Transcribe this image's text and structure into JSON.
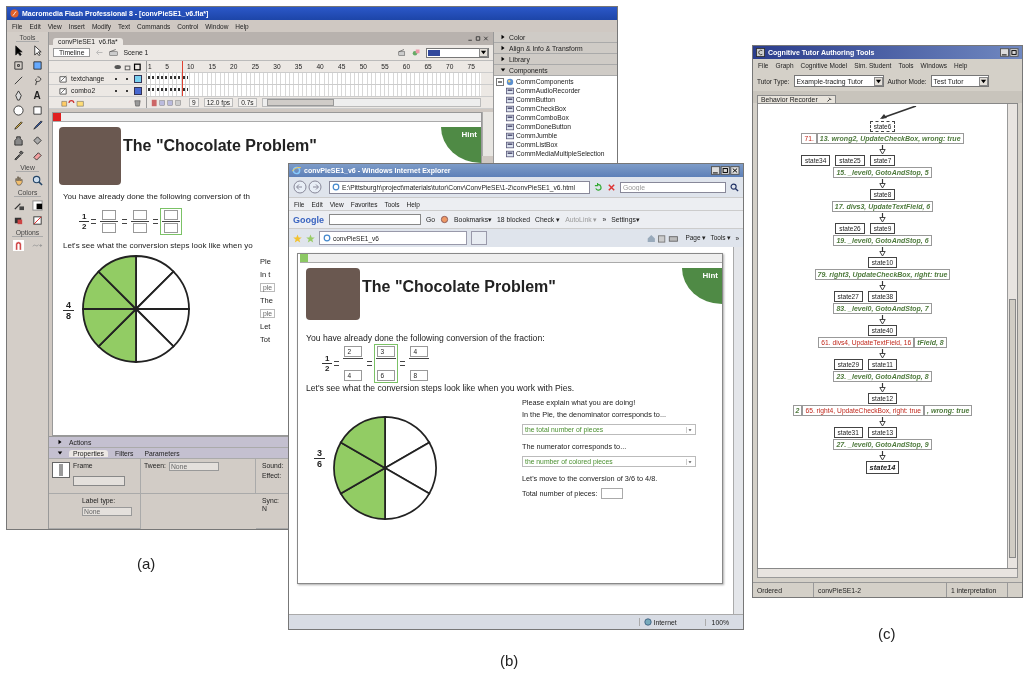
{
  "flash": {
    "title": "Macromedia Flash Professional 8 - [convPieSE1_v6.fla*]",
    "menu": [
      "File",
      "Edit",
      "View",
      "Insert",
      "Modify",
      "Text",
      "Commands",
      "Control",
      "Window",
      "Help"
    ],
    "tools": {
      "heading": "Tools",
      "text_tool": "A",
      "view": "View",
      "colors": "Colors",
      "options": "Options"
    },
    "doc_tab": "convPieSE1_v6.fla*",
    "timeline_button": "Timeline",
    "scene": "Scene 1",
    "frame_numbers": [
      "1",
      "5",
      "10",
      "15",
      "20",
      "25",
      "30",
      "35",
      "40",
      "45",
      "50",
      "55",
      "60",
      "65",
      "70",
      "75"
    ],
    "layers": [
      {
        "name": "textchange",
        "color": "#78d0f0"
      },
      {
        "name": "combo2",
        "color": "#4868d0"
      }
    ],
    "timeline_status": [
      "9",
      "12.0 fps",
      "0.7s"
    ],
    "stage": {
      "title": "The \"Chocolate Problem\"",
      "hint": "Hint",
      "intro": "You have already done the following conversion of th",
      "fraction": {
        "numerator": "1",
        "denominator": "2"
      },
      "steps": [
        {
          "highlighted": false
        },
        {
          "highlighted": false
        },
        {
          "highlighted": true
        }
      ],
      "pie_intro": "Let's see what the conversion steps look like when yo",
      "pie": {
        "numerator": "4",
        "denominator": "8",
        "slices": [
          {
            "filled": false
          },
          {
            "filled": false
          },
          {
            "filled": false
          },
          {
            "filled": false
          },
          {
            "filled": true
          },
          {
            "filled": true
          },
          {
            "filled": true
          },
          {
            "filled": true
          }
        ]
      },
      "side_texts": [
        {
          "kind": "text",
          "text": "Ple"
        },
        {
          "kind": "text",
          "text": "In t"
        },
        {
          "kind": "field",
          "text": "ple"
        },
        {
          "kind": "text",
          "text": "The"
        },
        {
          "kind": "field",
          "text": "ple"
        },
        {
          "kind": "text",
          "text": "Let"
        },
        {
          "kind": "text",
          "text": "Tot"
        }
      ]
    },
    "properties": {
      "actions": "Actions",
      "tabs": [
        {
          "label": "Properties",
          "selected": true
        },
        {
          "label": "Filters",
          "selected": false
        },
        {
          "label": "Parameters",
          "selected": false
        }
      ],
      "frame_label": "Frame",
      "tween_label": "Tween:",
      "tween_value": "None",
      "label_type_label": "Label type:",
      "label_type_value": "None",
      "sound_label": "Sound:",
      "effect_label": "Effect:",
      "sync_label": "Sync:",
      "cut_label": "N"
    },
    "side_panels": [
      {
        "label": "Color",
        "expanded": false
      },
      {
        "label": "Align & Info & Transform",
        "expanded": false
      },
      {
        "label": "Library",
        "expanded": false
      },
      {
        "label": "Components",
        "expanded": true
      }
    ],
    "components": {
      "folder": "CommComponents",
      "items": [
        "CommAudioRecorder",
        "CommButton",
        "CommCheckBox",
        "CommComboBox",
        "CommDoneButton",
        "CommJumble",
        "CommListBox",
        "CommMediaMultipleSelection"
      ]
    }
  },
  "browser": {
    "title": "convPieSE1_v6 - Windows Internet Explorer",
    "address": "E:\\Pittsburgh\\project\\materials\\tutor\\Conv\\ConvPieSE\\1-2\\convPieSE1_v6.html",
    "search_placeholder": "Google",
    "menu": [
      "File",
      "Edit",
      "View",
      "Favorites",
      "Tools",
      "Help"
    ],
    "toolbar": {
      "logo": "Google",
      "go": "Go",
      "items": [
        {
          "label": "Bookmarks▾",
          "disabled": false
        },
        {
          "label": "18 blocked",
          "disabled": false
        },
        {
          "label": "Check ▾",
          "disabled": false
        },
        {
          "label": "AutoLink ▾",
          "disabled": true
        },
        {
          "label": "»",
          "disabled": false
        },
        {
          "label": "Settings▾",
          "disabled": false
        }
      ]
    },
    "tab": "convPieSE1_v6",
    "commands": [
      "Page ▾",
      "Tools ▾",
      "»"
    ],
    "page": {
      "title": "The \"Chocolate Problem\"",
      "hint": "Hint",
      "intro": "You have already done the following conversion of the fraction:",
      "fraction": {
        "numerator": "1",
        "denominator": "2"
      },
      "steps": [
        {
          "numerator": "2",
          "denominator": "4",
          "highlighted": false
        },
        {
          "numerator": "3",
          "denominator": "6",
          "highlighted": true
        },
        {
          "numerator": "4",
          "denominator": "8",
          "highlighted": false
        }
      ],
      "pie_intro": "Let's see what the conversion steps look like when you work with Pies.",
      "pie": {
        "numerator": "3",
        "denominator": "6",
        "slices": [
          {
            "filled": false
          },
          {
            "filled": false
          },
          {
            "filled": false
          },
          {
            "filled": true
          },
          {
            "filled": true
          },
          {
            "filled": true
          }
        ]
      },
      "questions": [
        {
          "kind": "text",
          "text": "Please explain what you are doing!"
        },
        {
          "kind": "text",
          "text": "In the Pie, the denominator corresponds to..."
        },
        {
          "kind": "select",
          "text": "the total number of pieces"
        },
        {
          "kind": "text",
          "text": "The numerator corresponds to..."
        },
        {
          "kind": "select",
          "text": "the number of colored pieces"
        },
        {
          "kind": "text",
          "text": "Let's move to the conversion of 3/6 to 4/8."
        },
        {
          "kind": "input",
          "text": "Total number of pieces:"
        }
      ]
    },
    "status": {
      "zone": "Internet",
      "zoom": "100%"
    }
  },
  "ctat": {
    "title": "Cognitive Tutor Authoring Tools",
    "menu": [
      "File",
      "Graph",
      "Cognitive Model",
      "Sim. Student",
      "Tools",
      "Windows",
      "Help"
    ],
    "tutor_type_label": "Tutor Type:",
    "tutor_type": "Example-tracing Tutor",
    "author_mode_label": "Author Mode:",
    "author_mode": "Test Tutor",
    "tab": "Behavior Recorder",
    "graph": [
      {
        "kind": "nodes",
        "node": {
          "label": "state6",
          "kind": "unvisited"
        }
      },
      {
        "kind": "edge",
        "parts": [
          {
            "kind": "buggy",
            "text": "71."
          },
          {
            "kind": "action",
            "text": "13. wrong2, UpdateCheckBox, wrong: true"
          }
        ]
      },
      {
        "kind": "nodes",
        "branches": [
          "state34",
          "state25"
        ],
        "node": {
          "label": "state7",
          "kind": "state"
        }
      },
      {
        "kind": "edge",
        "parts": [
          {
            "kind": "action",
            "text": "15. _level0, GotoAndStop, 5"
          }
        ]
      },
      {
        "kind": "nodes",
        "node": {
          "label": "state8",
          "kind": "state"
        }
      },
      {
        "kind": "edge",
        "parts": [
          {
            "kind": "action",
            "text": "17. divs3, UpdateTextField, 6"
          }
        ]
      },
      {
        "kind": "nodes",
        "branches": [
          "state26"
        ],
        "node": {
          "label": "state9",
          "kind": "state"
        }
      },
      {
        "kind": "edge",
        "parts": [
          {
            "kind": "action",
            "text": "19. _level0, GotoAndStop, 6"
          }
        ]
      },
      {
        "kind": "nodes",
        "node": {
          "label": "state10",
          "kind": "state"
        }
      },
      {
        "kind": "edge",
        "parts": [
          {
            "kind": "action",
            "text": "79. right3, UpdateCheckBox, right: true"
          }
        ]
      },
      {
        "kind": "nodes",
        "branches": [
          "state27"
        ],
        "node": {
          "label": "state38",
          "kind": "state"
        }
      },
      {
        "kind": "edge",
        "parts": [
          {
            "kind": "action",
            "text": "83. _level0, GotoAndStop, 7"
          }
        ]
      },
      {
        "kind": "nodes",
        "node": {
          "label": "state40",
          "kind": "state"
        }
      },
      {
        "kind": "edge",
        "parts": [
          {
            "kind": "buggy",
            "text": "61. divs4, UpdateTextField, 16"
          },
          {
            "kind": "action",
            "text": "tField, 8"
          }
        ]
      },
      {
        "kind": "nodes",
        "branches": [
          "state29"
        ],
        "node": {
          "label": "state11",
          "kind": "state"
        }
      },
      {
        "kind": "edge",
        "parts": [
          {
            "kind": "action",
            "text": "23. _level0, GotoAndStop, 8"
          }
        ]
      },
      {
        "kind": "nodes",
        "node": {
          "label": "state12",
          "kind": "state"
        }
      },
      {
        "kind": "edge",
        "parts": [
          {
            "kind": "action",
            "text": "2"
          },
          {
            "kind": "buggy",
            "text": "65. right4, UpdateCheckBox, right: true"
          },
          {
            "kind": "action",
            "text": ", wrong: true"
          }
        ]
      },
      {
        "kind": "nodes",
        "branches": [
          "state31"
        ],
        "node": {
          "label": "state13",
          "kind": "state"
        }
      },
      {
        "kind": "edge",
        "parts": [
          {
            "kind": "action",
            "text": "27. _level0, GotoAndStop, 9"
          }
        ]
      },
      {
        "kind": "nodes",
        "node": {
          "label": "state14",
          "kind": "current"
        }
      }
    ],
    "status": [
      "Ordered",
      "convPieSE1-2",
      "1 interpretation"
    ]
  },
  "captions": [
    "(a)",
    "(b)",
    "(c)"
  ]
}
